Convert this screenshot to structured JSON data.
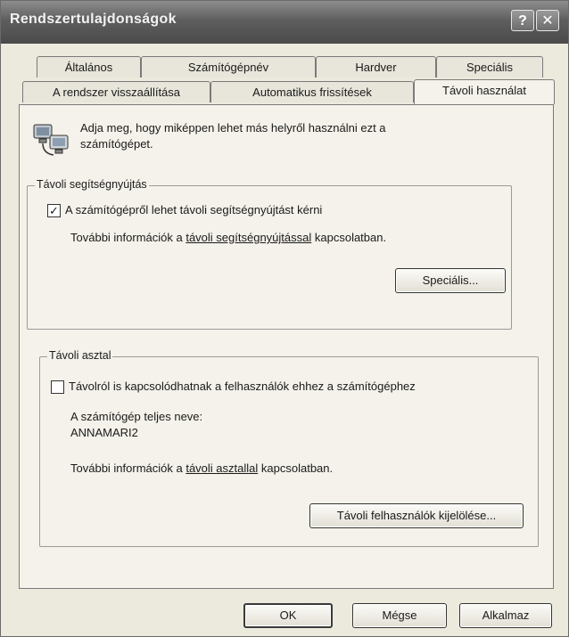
{
  "window": {
    "title": "Rendszertulajdonságok",
    "help_glyph": "?",
    "close_glyph": "✕"
  },
  "tabs_back": [
    "Általános",
    "Számítógépnév",
    "Hardver",
    "Speciális"
  ],
  "tabs_front": [
    "A rendszer visszaállítása",
    "Automatikus frissítések",
    "Távoli használat"
  ],
  "active_tab": "Távoli használat",
  "intro": {
    "icon": "network-computers-icon",
    "line1": "Adja meg, hogy miképpen lehet más helyről használni ezt a",
    "line2": "számítógépet."
  },
  "remote_assistance": {
    "group_title": "Távoli segítségnyújtás",
    "checkbox_label": "A számítógépről lehet távoli segítségnyújtást kérni",
    "checked": true,
    "info_prefix": "További információk a ",
    "info_link": "távoli segítségnyújtással",
    "info_suffix": " kapcsolatban.",
    "advanced_button": "Speciális..."
  },
  "remote_desktop": {
    "group_title": "Távoli asztal",
    "checkbox_label": "Távolról is kapcsolódhatnak a felhasználók ehhez a számítógéphez",
    "checked": false,
    "fullname_label": "A számítógép teljes neve:",
    "fullname_value": "ANNAMARI2",
    "info_prefix": "További információk a ",
    "info_link": "távoli asztallal",
    "info_suffix": " kapcsolatban.",
    "select_users_button": "Távoli felhasználók kijelölése..."
  },
  "footer": {
    "ok": "OK",
    "cancel": "Mégse",
    "apply": "Alkalmaz"
  },
  "check_glyph": "✓"
}
